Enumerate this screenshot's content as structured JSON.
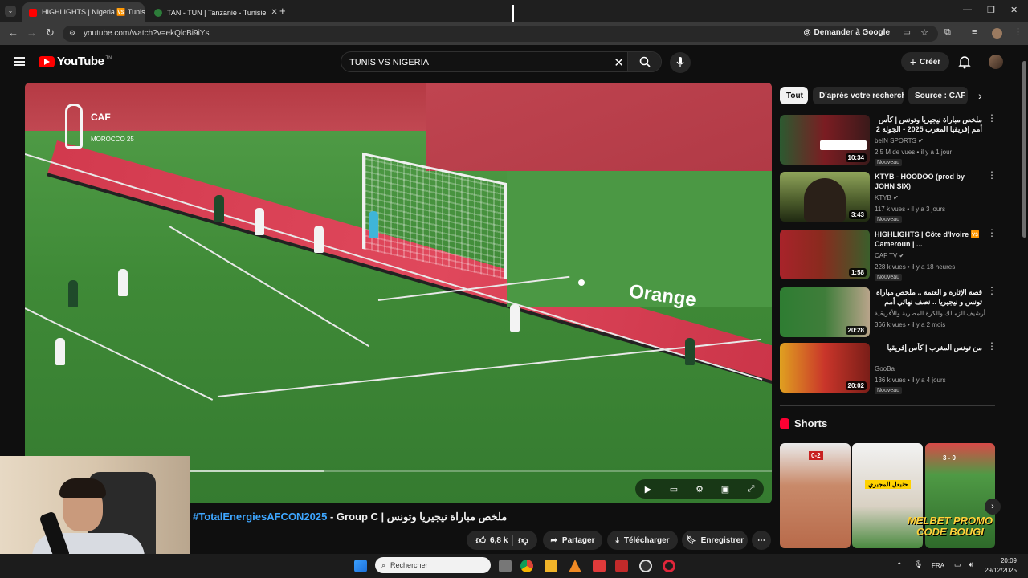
{
  "browser": {
    "tabs": [
      {
        "title": "HIGHLIGHTS | Nigeria 🆚 Tunisie",
        "active": true,
        "favicon_color": "#ff0000"
      },
      {
        "title": "TAN - TUN | Tanzanie - Tunisie",
        "active": false,
        "favicon_color": "#2d7d3a"
      }
    ],
    "url": "youtube.com/watch?v=ekQlcBi9iYs",
    "ask_google": "Demander à Google"
  },
  "youtube": {
    "logo_text": "YouTube",
    "logo_sup": "TN",
    "search": {
      "value": "TUNIS VS NIGERIA"
    },
    "create_label": "Créer"
  },
  "video": {
    "overlay_brand": "CAF",
    "overlay_sub": "MOROCCO 25",
    "board_sponsor": "Orange",
    "progress_fraction": 0.4,
    "title_tag": "#TotalEnergiesAFCON2025",
    "title_rest": " - Group C | ملخص مباراة نيجيريا وتونس",
    "actions": {
      "likes": "6,8 k",
      "share": "Partager",
      "download": "Télécharger",
      "save": "Enregistrer"
    }
  },
  "sidebar": {
    "chips": [
      "Tout",
      "D'après votre recherche",
      "Source : CAF TV"
    ],
    "recommendations": [
      {
        "title": "ملخص مباراة نيجيريا وتونس | كأس أمم إفريقيا المغرب 2025 - الجولة 2",
        "channel": "beIN SPORTS",
        "views": "2,5 M de vues",
        "age": "il y a 1 jour",
        "badge": "Nouveau",
        "duration": "10:34",
        "thumb": "#7b1c22"
      },
      {
        "title": "KTYB - HOODOO (prod by JOHN SIX)",
        "channel": "KTYB",
        "views": "117 k vues",
        "age": "il y a 3 jours",
        "badge": "Nouveau",
        "duration": "3:43",
        "thumb": "#4a5a2a"
      },
      {
        "title": "HIGHLIGHTS | Côte d'Ivoire 🆚 Cameroun | ...",
        "channel": "CAF TV",
        "views": "228 k vues",
        "age": "il y a 18 heures",
        "badge": "Nouveau",
        "duration": "1:58",
        "thumb": "#8a2a1e"
      },
      {
        "title": "قصة الإثارة و العتمة .. ملخص مباراة تونس و نيجيريا .. نصف نهائي أمم إفريقيا 2004",
        "channel": "أرشيف الزمالك والكرة المصرية والأفريقية",
        "views": "366 k vues",
        "age": "il y a 2 mois",
        "badge": "",
        "duration": "20:28",
        "thumb": "#3f7d3a"
      },
      {
        "title": "من تونس المغرب | كأس إفريقيا",
        "channel": "GooBa",
        "views": "136 k vues",
        "age": "il y a 4 jours",
        "badge": "Nouveau",
        "duration": "20:02",
        "thumb": "#c9352a"
      }
    ],
    "shorts_header": "Shorts",
    "shorts": [
      {
        "color": "#c98a6a",
        "overlay": "0-2"
      },
      {
        "color": "#d9d1c3",
        "overlay": "حنبعل المجبري"
      },
      {
        "color": "#4f9a45",
        "overlay": "3 - 0"
      }
    ],
    "promo_text": "MELBET PROMO CODE BOUGI"
  },
  "taskbar": {
    "search_placeholder": "Rechercher",
    "lang": "FRA",
    "time": "20:09",
    "date": "29/12/2025"
  }
}
